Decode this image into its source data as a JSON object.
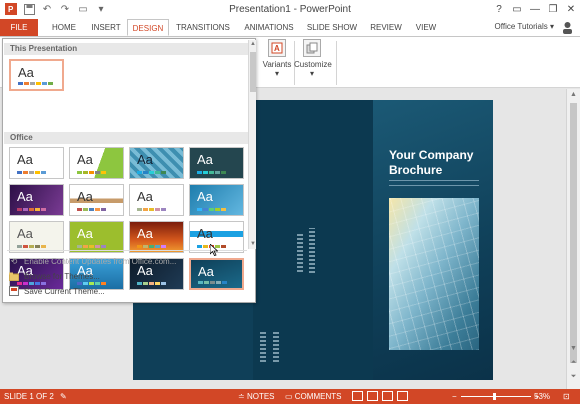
{
  "window": {
    "title": "Presentation1 - PowerPoint",
    "help": "?",
    "minimize": "—",
    "restore": "❐",
    "close": "✕"
  },
  "tabs": {
    "file": "FILE",
    "home": "HOME",
    "insert": "INSERT",
    "design": "DESIGN",
    "transitions": "TRANSITIONS",
    "animations": "ANIMATIONS",
    "slideshow": "SLIDE SHOW",
    "review": "REVIEW",
    "view": "VIEW",
    "account": "Office Tutorials ▾"
  },
  "ribbon": {
    "variants": "Variants",
    "customize": "Customize"
  },
  "gallery": {
    "section_this": "This Presentation",
    "section_office": "Office",
    "aa": "Aa",
    "menu_enable_updates": "Enable Content Updates from Office.com...",
    "menu_browse": "Browse for Themes...",
    "menu_save": "Save Current Theme..."
  },
  "slide": {
    "headline": "Your Company Brochure"
  },
  "status": {
    "slide_info": "SLIDE 1 OF 2",
    "notes": "NOTES",
    "comments": "COMMENTS",
    "zoom": "53%"
  },
  "colors": {
    "accent": "#d24726",
    "slide_bg": "#0f3f58"
  }
}
